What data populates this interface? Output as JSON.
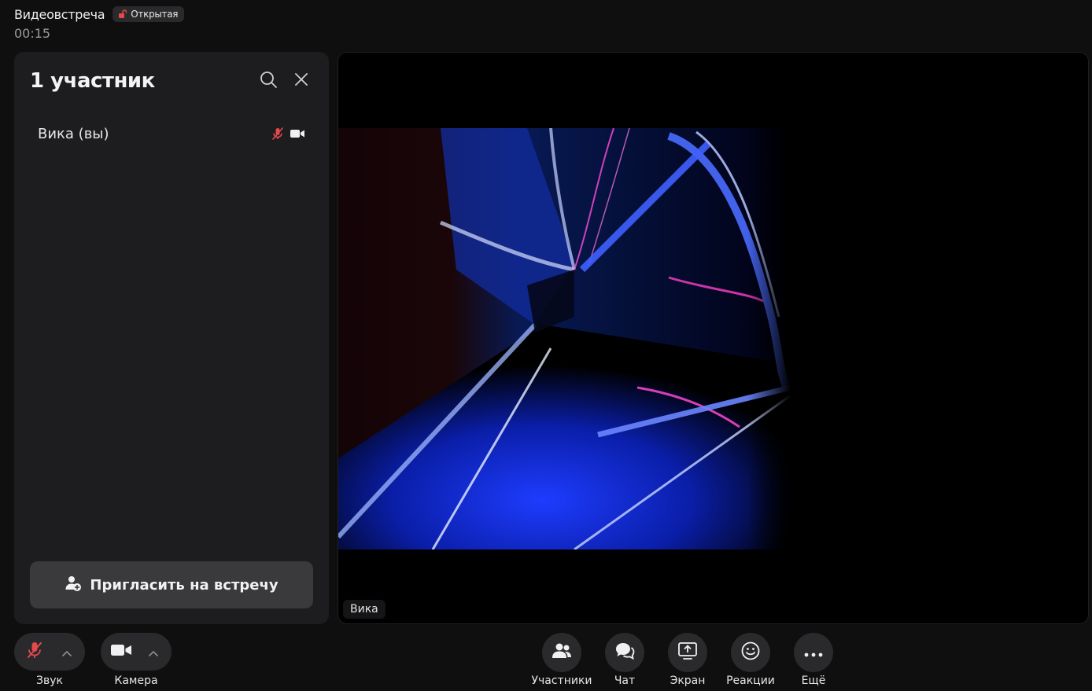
{
  "header": {
    "title": "Видеовстреча",
    "badge": "Открытая",
    "timer": "00:15"
  },
  "participants_panel": {
    "title": "1 участник",
    "participants": [
      {
        "name": "Вика (вы)",
        "mic": "muted",
        "camera": "on"
      }
    ],
    "invite_label": "Пригласить на встречу"
  },
  "stage": {
    "name_tag": "Вика"
  },
  "controls": {
    "sound_label": "Звук",
    "camera_label": "Камера",
    "participants_label": "Участники",
    "chat_label": "Чат",
    "screen_label": "Экран",
    "reactions_label": "Реакции",
    "more_label": "Ещё"
  },
  "colors": {
    "muted": "#e5484d",
    "background": "#0f0f10",
    "panel": "#1d1d1f"
  }
}
